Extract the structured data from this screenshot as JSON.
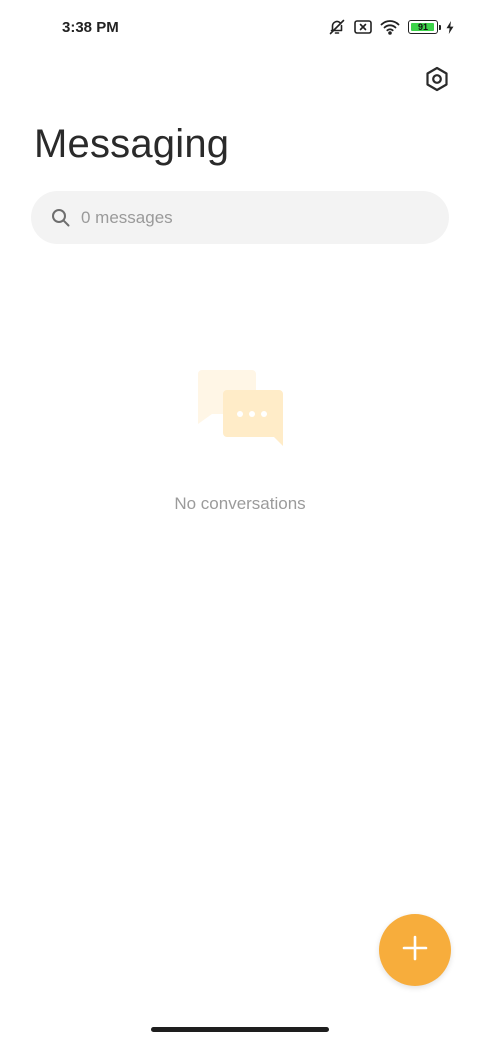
{
  "status_bar": {
    "time": "3:38 PM",
    "battery_level": "91",
    "battery_fraction": 0.91,
    "icons": [
      "bell-off-icon",
      "sim-x-icon",
      "wifi-icon",
      "battery-icon",
      "charging-bolt-icon"
    ]
  },
  "header": {
    "title": "Messaging",
    "settings_icon": "settings-hexagon-icon"
  },
  "search": {
    "placeholder": "0 messages",
    "value": ""
  },
  "empty_state": {
    "illustration_icon": "chat-bubbles-icon",
    "text": "No conversations"
  },
  "fab": {
    "icon": "plus-icon"
  },
  "colors": {
    "accent": "#f7ad3c",
    "battery_fill": "#3dd34a",
    "search_bg": "#f3f3f3",
    "muted_text": "#9b9b9b"
  }
}
